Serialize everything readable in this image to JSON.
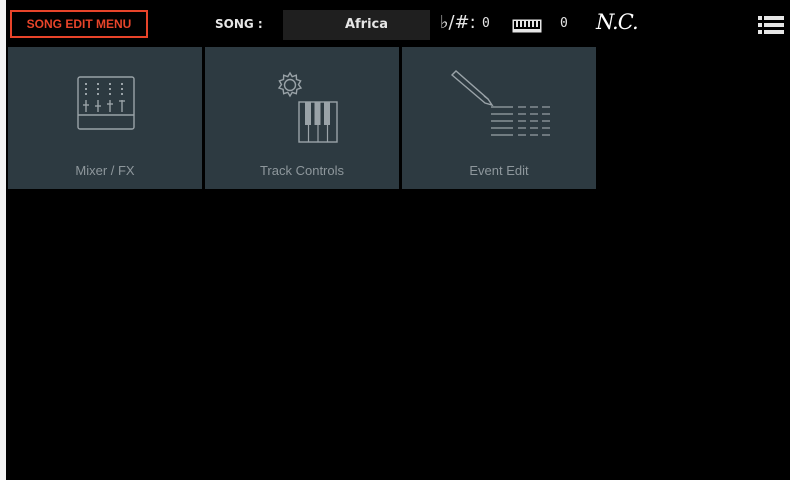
{
  "header": {
    "menu_title": "SONG EDIT MENU",
    "song_label": "SONG :",
    "song_name": "Africa",
    "transpose_icon": "flat-sharp-icon",
    "transpose_symbol": "♭/#:",
    "transpose_value": "0",
    "keyboard_icon": "keyboard-icon",
    "keyboard_value": "0",
    "chord": "N.C.",
    "menu_icon": "list-menu-icon"
  },
  "tiles": [
    {
      "label": "Mixer / FX",
      "icon": "mixer-icon"
    },
    {
      "label": "Track Controls",
      "icon": "track-controls-icon"
    },
    {
      "label": "Event Edit",
      "icon": "event-edit-icon"
    }
  ],
  "colors": {
    "accent": "#e8442a",
    "tile_bg": "#2d3a41",
    "tile_text": "#8e979c",
    "background": "#000000"
  }
}
